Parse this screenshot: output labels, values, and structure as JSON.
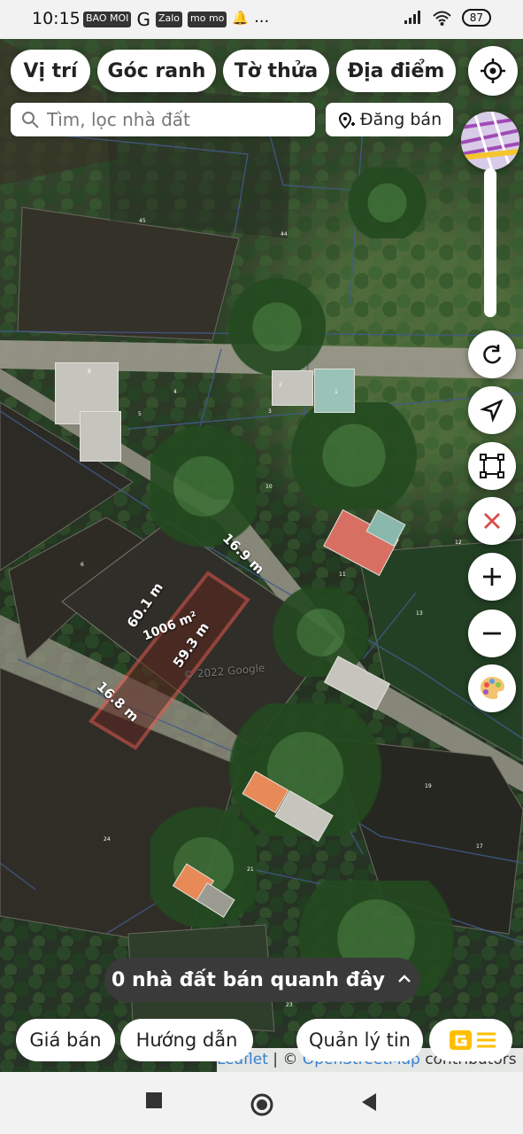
{
  "status": {
    "time": "10:15",
    "icons": [
      "BAO MOI",
      "G",
      "Zalo",
      "mo mo",
      "bell",
      "..."
    ],
    "battery": "87"
  },
  "top_tabs": [
    "Vị trí",
    "Góc ranh",
    "Tờ thửa",
    "Địa điểm"
  ],
  "search": {
    "placeholder": "Tìm, lọc nhà đất",
    "sell_label": "Đăng bán"
  },
  "map": {
    "parcel": {
      "top_edge": "16.9 m",
      "bottom_edge": "16.8 m",
      "left_edge": "60.1 m",
      "right_edge": "59.3 m",
      "area": "1006 m²"
    },
    "watermark": "© 2022 Google",
    "parcel_numbers": [
      "45",
      "44",
      "8",
      "4",
      "5",
      "2",
      "3",
      "1",
      "10",
      "11",
      "12",
      "13",
      "6",
      "19",
      "17",
      "24",
      "21",
      "23"
    ]
  },
  "bottom_sheet": {
    "label": "0 nhà đất bán quanh đây"
  },
  "bottom_buttons": {
    "price": "Giá bán",
    "guide": "Hướng dẫn",
    "manage": "Quản lý tin"
  },
  "credits": {
    "leaflet": "Leaflet",
    "separator": "|",
    "copyright": "©",
    "source": "OpenStreetMap",
    "contributors": "contributors"
  },
  "colors": {
    "parcel_red": "#e4574e",
    "tab_text": "#222222",
    "chip_orange": "#ffbf00"
  }
}
